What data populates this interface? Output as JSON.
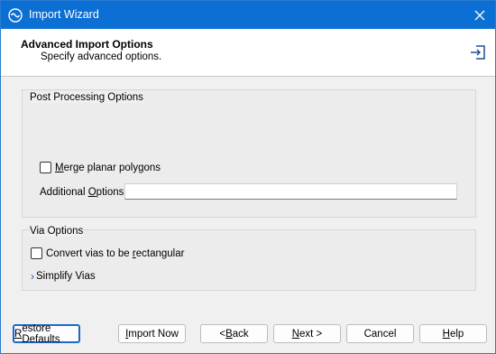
{
  "window": {
    "title": "Import Wizard"
  },
  "header": {
    "title": "Advanced Import Options",
    "subtitle": "Specify advanced options."
  },
  "post_processing": {
    "label": "Post Processing Options",
    "merge_label_pre": "",
    "merge_label_mn": "M",
    "merge_label_post": "erge planar polygons",
    "merge_checked": false,
    "additional_label_pre": "Additional ",
    "additional_label_mn": "O",
    "additional_label_post": "ptions",
    "additional_value": ""
  },
  "via_options": {
    "label": "Via Options",
    "convert_label_pre": "Convert vias to be ",
    "convert_label_mn": "r",
    "convert_label_post": "ectangular",
    "convert_checked": false,
    "simplify_label": "Simplify Vias"
  },
  "buttons": {
    "restore_pre": "",
    "restore_mn": "R",
    "restore_post": "estore Defaults",
    "import_pre": "",
    "import_mn": "I",
    "import_post": "mport Now",
    "back_pre": "< ",
    "back_mn": "B",
    "back_post": "ack",
    "next_pre": "",
    "next_mn": "N",
    "next_post": "ext >",
    "cancel": "Cancel",
    "help_pre": "",
    "help_mn": "H",
    "help_post": "elp"
  }
}
